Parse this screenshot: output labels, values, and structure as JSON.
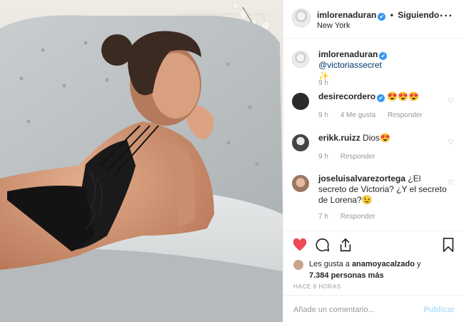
{
  "header": {
    "username": "imlorenaduran",
    "verified_mark": "✔",
    "separator": "•",
    "follow_status": "Siguiendo",
    "location": "New York",
    "more_icon": "more-horizontal-icon"
  },
  "caption": {
    "username": "imlorenaduran",
    "verified_mark": "✔",
    "mention": "@victoriassecret",
    "emoji": "✨",
    "time": "9 h"
  },
  "comments": [
    {
      "username": "desirecordero",
      "verified_mark": "✔",
      "text": "😍😍😍",
      "time": "9 h",
      "likes": "4 Me gusta",
      "reply": "Responder"
    },
    {
      "username": "erikk.ruizz",
      "text": "Dios😍",
      "time": "9 h",
      "reply": "Responder"
    },
    {
      "username": "joseluisalvarezortega",
      "text": "¿El secreto de Victoria? ¿Y el secreto de Lorena?😉",
      "time": "7 h",
      "reply": "Responder"
    }
  ],
  "actions": {
    "like_icon": "heart-filled-icon",
    "comment_icon": "comment-bubble-icon",
    "share_icon": "share-icon",
    "save_icon": "bookmark-icon",
    "like_color": "#ed4956"
  },
  "likes": {
    "prefix": "Les gusta a",
    "user": "anamoyacalzado",
    "joiner": "y",
    "count": "7.384 personas más"
  },
  "posted_ago": "HACE 9 HORAS",
  "add_comment": {
    "placeholder": "Añade un comentario...",
    "publish": "Publicar"
  }
}
